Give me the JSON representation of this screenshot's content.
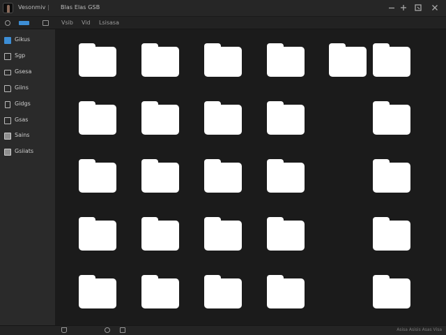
{
  "titlebar": {
    "left_text": "Vesonmiv",
    "separator": "|",
    "right_text": "Blas Elas GSB",
    "controls": [
      "minimize-icon",
      "maximize-icon",
      "restore-icon",
      "close-icon"
    ]
  },
  "toolbar": {
    "icons": [
      "search-icon",
      "view-toggle-icon",
      "layout-icon"
    ],
    "items": [
      "Vsib",
      "Vid",
      "Lsisasa"
    ]
  },
  "sidebar": {
    "items": [
      {
        "label": "Gikus",
        "icon": "checkbox-icon",
        "active": true
      },
      {
        "label": "Sgp",
        "icon": "square-icon"
      },
      {
        "label": "Gsesa",
        "icon": "card-icon"
      },
      {
        "label": "Giins",
        "icon": "folder-icon"
      },
      {
        "label": "Gidgs",
        "icon": "file-icon"
      },
      {
        "label": "Gsas",
        "icon": "box-icon"
      },
      {
        "label": "Sains",
        "icon": "box-filled-icon"
      },
      {
        "label": "Gsiiats",
        "icon": "box-filled-icon"
      }
    ]
  },
  "main": {
    "folders": [
      {
        "row": 1,
        "col": 1
      },
      {
        "row": 1,
        "col": 2
      },
      {
        "row": 1,
        "col": 3
      },
      {
        "row": 1,
        "col": 4
      },
      {
        "row": 1,
        "col": 5
      },
      {
        "row": 1,
        "col": 6
      },
      {
        "row": 2,
        "col": 1
      },
      {
        "row": 2,
        "col": 2
      },
      {
        "row": 2,
        "col": 3
      },
      {
        "row": 2,
        "col": 4
      },
      {
        "row": 2,
        "col": 6
      },
      {
        "row": 3,
        "col": 1
      },
      {
        "row": 3,
        "col": 2
      },
      {
        "row": 3,
        "col": 3
      },
      {
        "row": 3,
        "col": 4
      },
      {
        "row": 3,
        "col": 6
      },
      {
        "row": 4,
        "col": 1
      },
      {
        "row": 4,
        "col": 2
      },
      {
        "row": 4,
        "col": 3
      },
      {
        "row": 4,
        "col": 4
      },
      {
        "row": 4,
        "col": 6
      },
      {
        "row": 5,
        "col": 1
      },
      {
        "row": 5,
        "col": 2
      },
      {
        "row": 5,
        "col": 3
      },
      {
        "row": 5,
        "col": 4
      },
      {
        "row": 5,
        "col": 6
      }
    ]
  },
  "statusbar": {
    "icons": [
      "filter-icon",
      "chat-icon",
      "panel-icon"
    ],
    "text": "Asisa Asisis Asas Visa"
  }
}
